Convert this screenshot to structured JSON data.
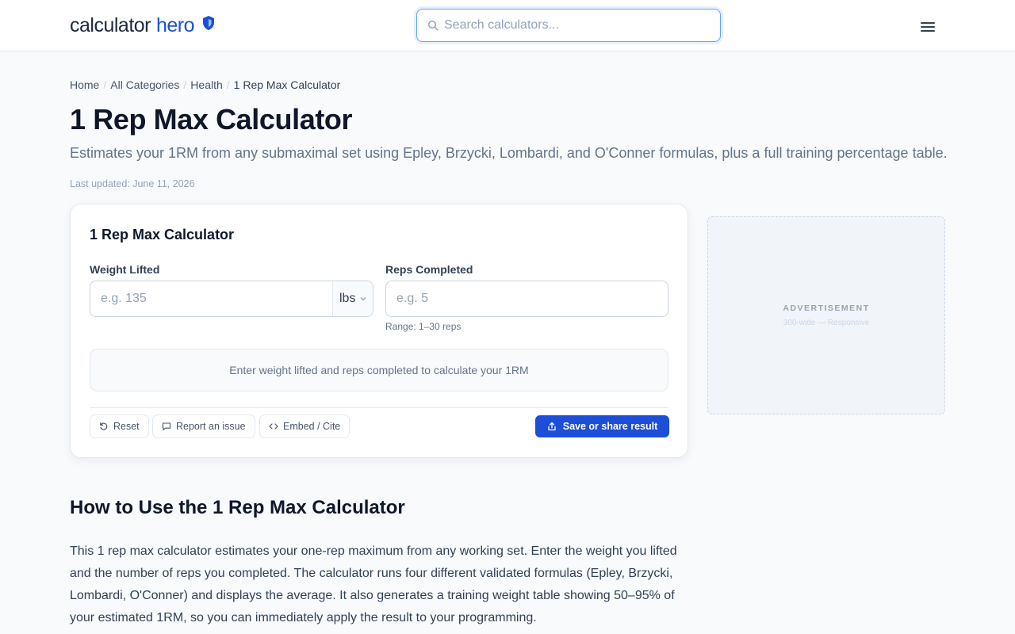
{
  "header": {
    "logo_part1": "calculator",
    "logo_part2": "hero",
    "search_placeholder": "Search calculators...",
    "brand_color": "#1d4ed8"
  },
  "breadcrumb": {
    "items": [
      "Home",
      "All Categories",
      "Health"
    ],
    "separator": "/",
    "current": "1 Rep Max Calculator"
  },
  "page": {
    "title": "1 Rep Max Calculator",
    "subtitle": "Estimates your 1RM from any submaximal set using Epley, Brzycki, Lombardi, and O'Conner formulas, plus a full training percentage table.",
    "last_updated": "Last updated: June 11, 2026"
  },
  "calculator": {
    "title": "1 Rep Max Calculator",
    "weight_label": "Weight Lifted",
    "weight_placeholder": "e.g. 135",
    "weight_unit": "lbs",
    "reps_label": "Reps Completed",
    "reps_placeholder": "e.g. 5",
    "reps_hint": "Range: 1–30 reps",
    "result_prompt": "Enter weight lifted and reps completed to calculate your 1RM",
    "actions": {
      "reset": "Reset",
      "report": "Report an issue",
      "embed": "Embed / Cite",
      "save": "Save or share result"
    }
  },
  "ad": {
    "label": "ADVERTISEMENT",
    "sub": "300-wide — Responsive"
  },
  "howto": {
    "title": "How to Use the 1 Rep Max Calculator",
    "body": "This 1 rep max calculator estimates your one-rep maximum from any working set. Enter the weight you lifted and the number of reps you completed. The calculator runs four different validated formulas (Epley, Brzycki, Lombardi, O'Conner) and displays the average. It also generates a training weight table showing 50–95% of your estimated 1RM, so you can immediately apply the result to your programming."
  },
  "icons": [
    "shield-icon",
    "search-icon",
    "hamburger-menu-icon",
    "chevron-down-icon",
    "reset-icon",
    "comment-icon",
    "code-icon",
    "share-icon"
  ]
}
